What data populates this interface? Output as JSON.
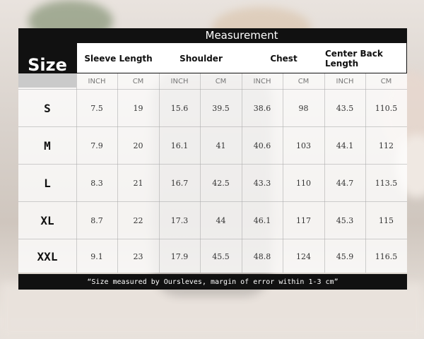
{
  "table": {
    "title": "Measurement",
    "size_label": "Size",
    "headers": [
      "Sleeve Length",
      "Shoulder",
      "Chest",
      "Center Back Length"
    ],
    "units": [
      "INCH",
      "CM",
      "INCH",
      "CM",
      "INCH",
      "CM",
      "INCH",
      "CM"
    ],
    "rows": [
      {
        "size": "S",
        "values": [
          "7.5",
          "19",
          "15.6",
          "39.5",
          "38.6",
          "98",
          "43.5",
          "110.5"
        ]
      },
      {
        "size": "M",
        "values": [
          "7.9",
          "20",
          "16.1",
          "41",
          "40.6",
          "103",
          "44.1",
          "112"
        ]
      },
      {
        "size": "L",
        "values": [
          "8.3",
          "21",
          "16.7",
          "42.5",
          "43.3",
          "110",
          "44.7",
          "113.5"
        ]
      },
      {
        "size": "XL",
        "values": [
          "8.7",
          "22",
          "17.3",
          "44",
          "46.1",
          "117",
          "45.3",
          "115"
        ]
      },
      {
        "size": "XXL",
        "values": [
          "9.1",
          "23",
          "17.9",
          "45.5",
          "48.8",
          "124",
          "45.9",
          "116.5"
        ]
      }
    ],
    "footer_note": "“Size measured by Oursleves, margin of error within 1-3 cm”"
  },
  "colors": {
    "header_background": "#111111",
    "header_text": "#ffffff",
    "body_background": "#ffffff"
  }
}
